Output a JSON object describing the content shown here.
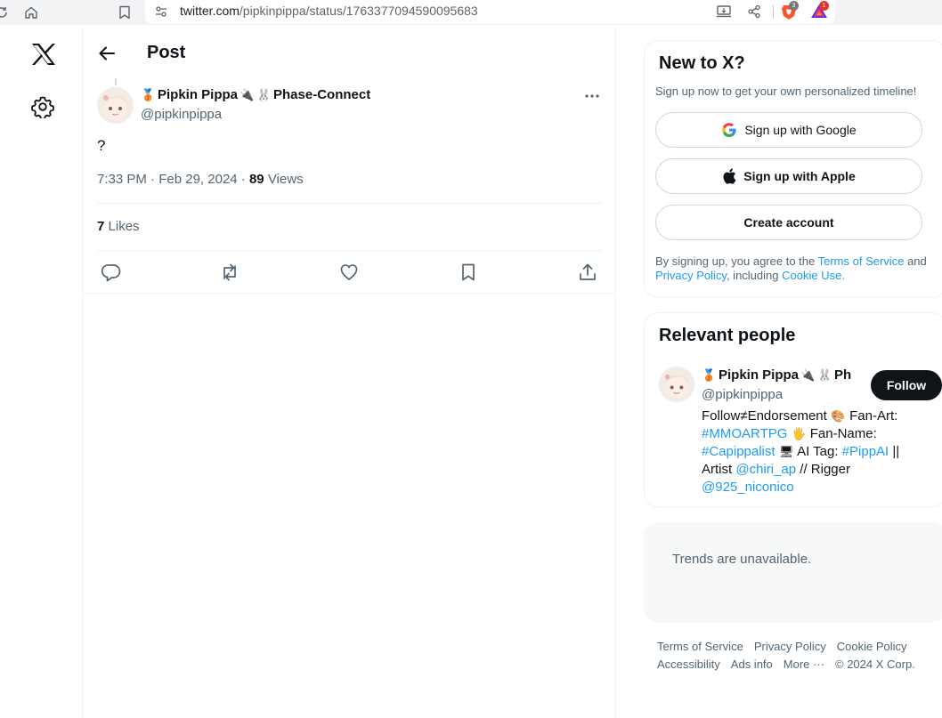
{
  "browser": {
    "url_host": "twitter.com",
    "url_path": "/pipkinpippa/status/1763377094590095683",
    "brave_badge_count": "3",
    "rewards_badge_count": "1"
  },
  "header": {
    "title": "Post"
  },
  "post": {
    "author_name": "Pipkin Pippa",
    "author_suffix": "Phase-Connect",
    "author_handle": "@pipkinpippa",
    "text": "?",
    "time": "7:33 PM",
    "date": "Feb 29, 2024",
    "views_count": "89",
    "views_label": "Views",
    "likes_count": "7",
    "likes_label": "Likes"
  },
  "new_to_x": {
    "title": "New to X?",
    "subtitle": "Sign up now to get your own personalized timeline!",
    "google_label": "Sign up with Google",
    "apple_label": "Sign up with Apple",
    "create_label": "Create account",
    "terms_prefix": "By signing up, you agree to the",
    "terms_link": "Terms of Service",
    "terms_and": "and",
    "privacy_link": "Privacy Policy",
    "terms_including": ", including",
    "cookie_link": "Cookie Use."
  },
  "relevant_people": {
    "title": "Relevant people",
    "name": "Pipkin Pippa",
    "name_suffix": "Ph",
    "handle": "@pipkinpippa",
    "follow_label": "Follow",
    "bio": {
      "part1": "Follow≠Endorsement",
      "part2": "Fan-Art:",
      "tag1": "#MMOARTPG",
      "part3": "Fan-Name:",
      "tag2": "#Capippalist",
      "part4": "AI Tag:",
      "tag3": "#PippAI",
      "part5": "|| Artist",
      "mention1": "@chiri_ap",
      "part6": "// Rigger",
      "mention2": "@925_niconico"
    }
  },
  "trends": {
    "message": "Trends are unavailable."
  },
  "footer": {
    "links": [
      "Terms of Service",
      "Privacy Policy",
      "Cookie Policy",
      "Accessibility",
      "Ads info",
      "More ···",
      "© 2024 X Corp."
    ]
  },
  "icons": {
    "brand": "x-logo-icon",
    "settings": "gear-icon",
    "back": "arrow-left-icon",
    "more": "ellipsis-icon",
    "reply": "reply-icon",
    "repost": "repost-icon",
    "like": "heart-icon",
    "bookmark": "bookmark-icon",
    "share": "share-icon"
  },
  "colors": {
    "accent": "#1d9bf0",
    "text_primary": "#0f1419",
    "text_secondary": "#536471",
    "follow_button": "#0f1419"
  }
}
